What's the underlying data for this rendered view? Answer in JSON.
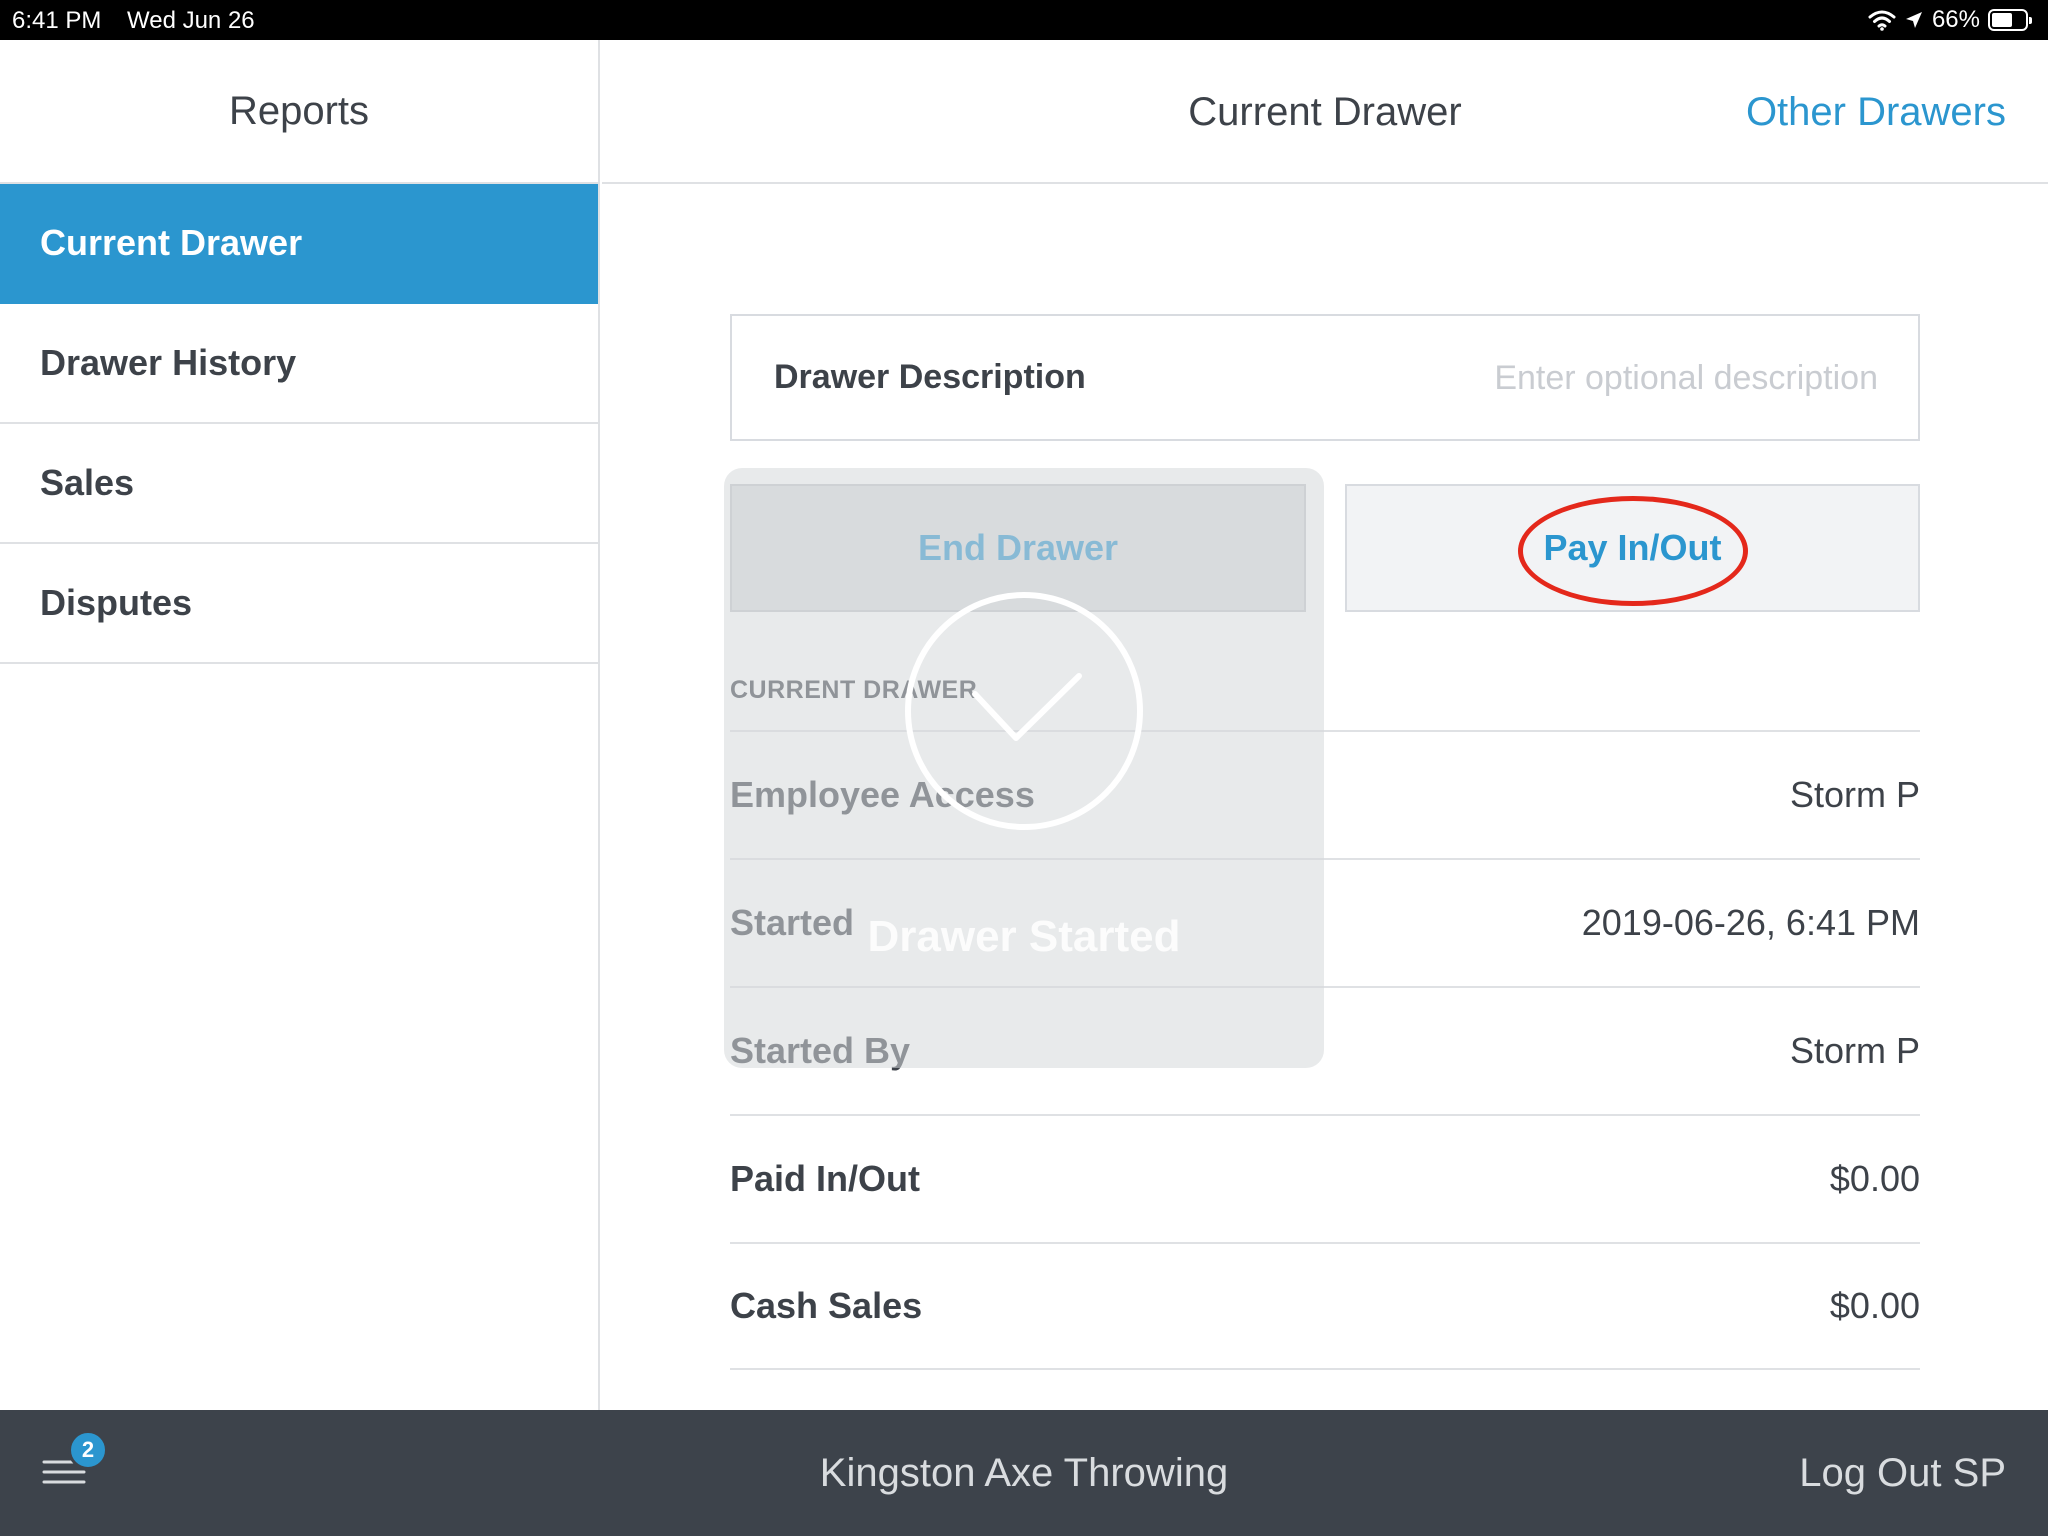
{
  "status_bar": {
    "time": "6:41 PM",
    "date": "Wed Jun 26",
    "battery_text": "66%",
    "battery_level": 0.66,
    "icons": [
      "wifi-icon",
      "location-icon",
      "battery-icon"
    ]
  },
  "sidebar": {
    "title": "Reports",
    "items": [
      {
        "label": "Current Drawer",
        "active": true
      },
      {
        "label": "Drawer History",
        "active": false
      },
      {
        "label": "Sales",
        "active": false
      },
      {
        "label": "Disputes",
        "active": false
      }
    ]
  },
  "header": {
    "title": "Current Drawer",
    "action_label": "Other Drawers"
  },
  "description": {
    "label": "Drawer Description",
    "value": "",
    "placeholder": "Enter optional description"
  },
  "buttons": {
    "end_drawer": "End Drawer",
    "pay_in_out": "Pay In/Out"
  },
  "section": {
    "title": "CURRENT DRAWER",
    "rows": [
      {
        "label": "Employee Access",
        "value": "Storm P"
      },
      {
        "label": "Started",
        "value": "2019-06-26, 6:41 PM"
      },
      {
        "label": "Started By",
        "value": "Storm P"
      },
      {
        "label": "Paid In/Out",
        "value": "$0.00"
      },
      {
        "label": "Cash Sales",
        "value": "$0.00"
      }
    ]
  },
  "toast": {
    "message": "Drawer Started",
    "icon": "checkmark-circle-icon"
  },
  "bottom_bar": {
    "notification_count": "2",
    "business_name": "Kingston Axe Throwing",
    "logout_label": "Log Out SP"
  },
  "colors": {
    "accent": "#2b96cf",
    "text": "#3d4249",
    "bottom_bar": "#3d434b",
    "annotation": "#e4281b"
  }
}
